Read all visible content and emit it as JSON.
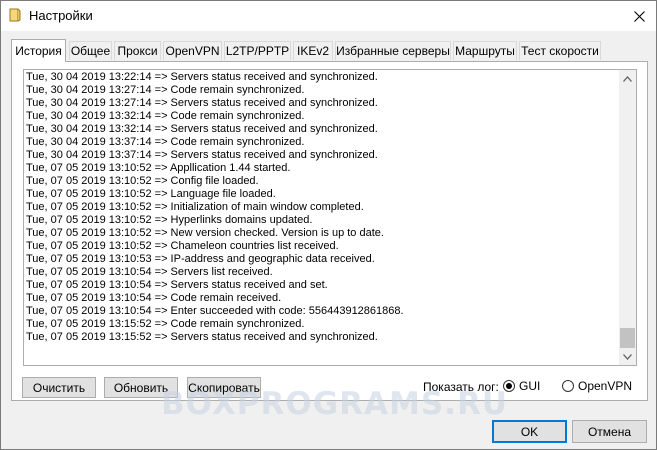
{
  "window": {
    "title": "Настройки"
  },
  "tabs": [
    {
      "label": "История",
      "active": true
    },
    {
      "label": "Общее"
    },
    {
      "label": "Прокси"
    },
    {
      "label": "OpenVPN"
    },
    {
      "label": "L2TP/PPTP"
    },
    {
      "label": "IKEv2"
    },
    {
      "label": "Избранные серверы"
    },
    {
      "label": "Маршруты"
    },
    {
      "label": "Тест скорости"
    }
  ],
  "log": [
    "Tue, 30 04 2019 13:22:14 => Servers status received and synchronized.",
    "Tue, 30 04 2019 13:27:14 => Code remain synchronized.",
    "Tue, 30 04 2019 13:27:14 => Servers status received and synchronized.",
    "Tue, 30 04 2019 13:32:14 => Code remain synchronized.",
    "Tue, 30 04 2019 13:32:14 => Servers status received and synchronized.",
    "Tue, 30 04 2019 13:37:14 => Code remain synchronized.",
    "Tue, 30 04 2019 13:37:14 => Servers status received and synchronized.",
    "Tue, 07 05 2019 13:10:52 => Appllication 1.44 started.",
    "Tue, 07 05 2019 13:10:52 => Config file loaded.",
    "Tue, 07 05 2019 13:10:52 => Language file loaded.",
    "Tue, 07 05 2019 13:10:52 => Initialization of main window completed.",
    "Tue, 07 05 2019 13:10:52 => Hyperlinks domains updated.",
    "Tue, 07 05 2019 13:10:52 => New version checked. Version is up to date.",
    "Tue, 07 05 2019 13:10:52 => Chameleon countries list received.",
    "Tue, 07 05 2019 13:10:53 => IP-address and geographic data received.",
    "Tue, 07 05 2019 13:10:54 => Servers list received.",
    "Tue, 07 05 2019 13:10:54 => Servers status received and set.",
    "Tue, 07 05 2019 13:10:54 => Code remain received.",
    "Tue, 07 05 2019 13:10:54 => Enter succeeded with code: 556443912861868.",
    "Tue, 07 05 2019 13:15:52 => Code remain synchronized.",
    "Tue, 07 05 2019 13:15:52 => Servers status received and synchronized."
  ],
  "actions": {
    "clear": "Очистить",
    "refresh": "Обновить",
    "copy": "Скопировать"
  },
  "show_log": {
    "label": "Показать лог:",
    "options": [
      "GUI",
      "OpenVPN"
    ],
    "selected": "GUI"
  },
  "footer": {
    "ok": "OK",
    "cancel": "Отмена"
  },
  "watermark": "BOXPROGRAMS.RU",
  "colors": {
    "accent": "#0078d7",
    "tab_border": "#adadad"
  }
}
